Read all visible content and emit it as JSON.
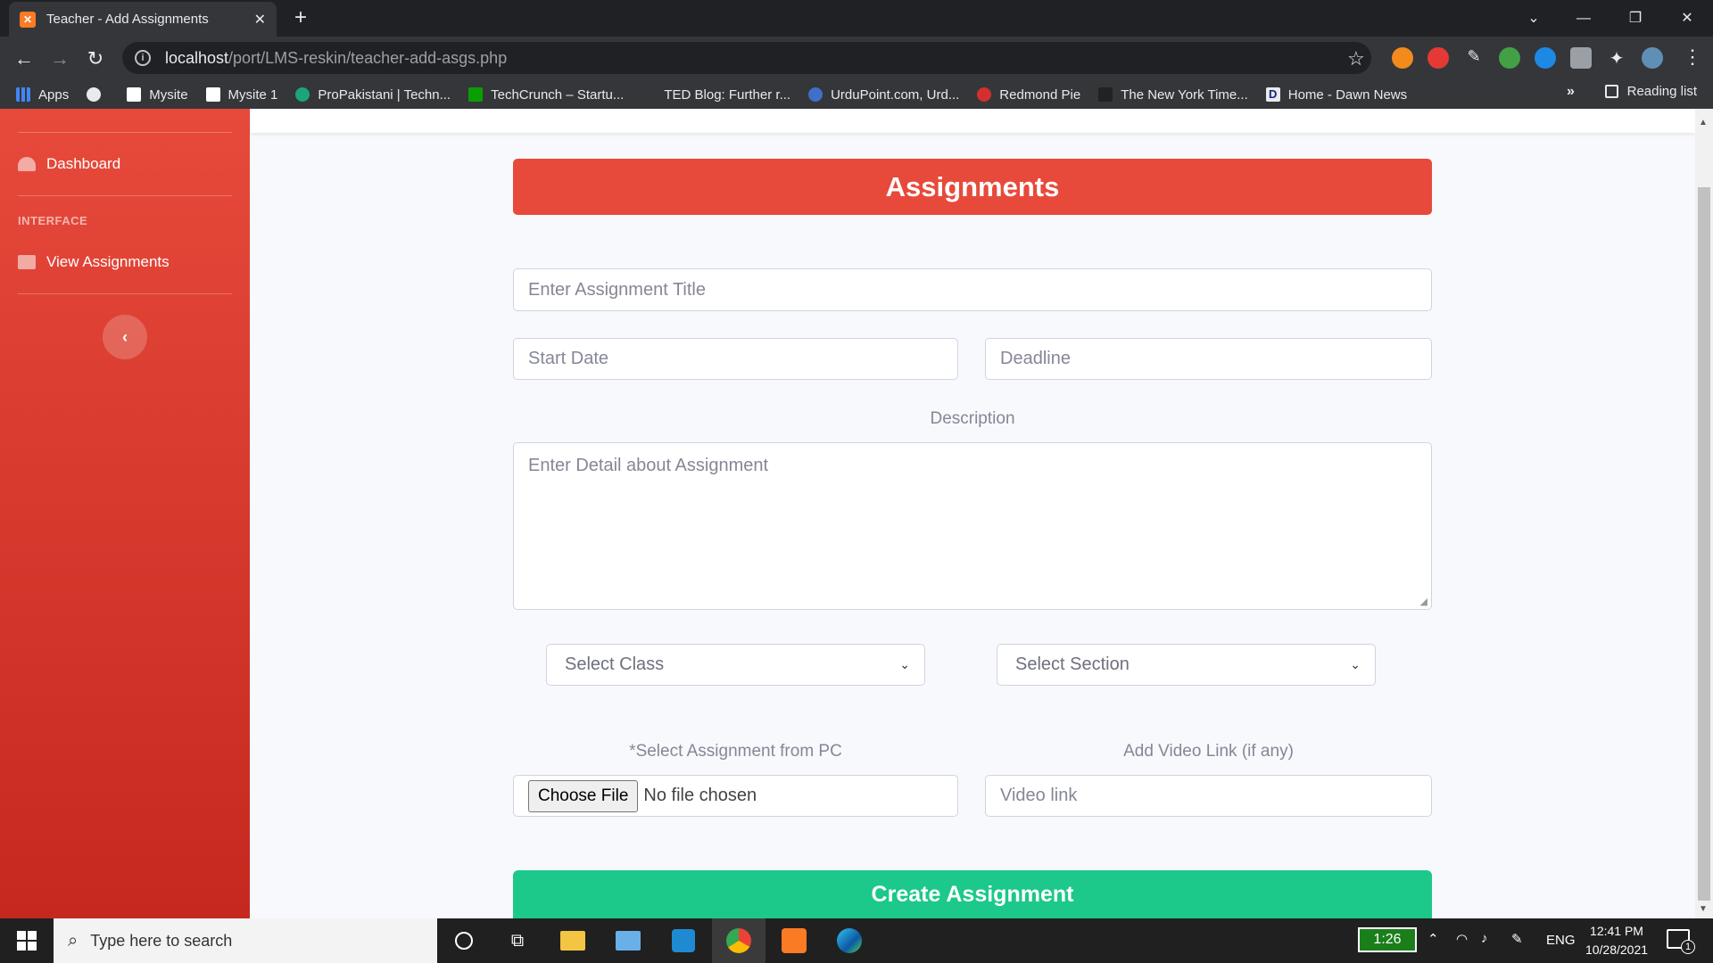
{
  "browser": {
    "tab_title": "Teacher - Add Assignments",
    "tab_favicon": "xampp-icon",
    "url_host": "localhost",
    "url_path": "/port/LMS-reskin/teacher-add-asgs.php",
    "bookmarks": [
      {
        "label": "Apps",
        "icon": "apps-grid-icon"
      },
      {
        "label": "",
        "icon": "globe-icon"
      },
      {
        "label": "Mysite",
        "icon": "wix-icon"
      },
      {
        "label": "Mysite 1",
        "icon": "wix-icon"
      },
      {
        "label": "ProPakistani | Techn...",
        "icon": "propakistani-icon"
      },
      {
        "label": "TechCrunch – Startu...",
        "icon": "techcrunch-icon"
      },
      {
        "label": "TED Blog: Further r...",
        "icon": "ted-icon"
      },
      {
        "label": "UrduPoint.com, Urd...",
        "icon": "urdupoint-icon"
      },
      {
        "label": "Redmond Pie",
        "icon": "redmondpie-icon"
      },
      {
        "label": "The New York Time...",
        "icon": "nyt-icon"
      },
      {
        "label": "Home - Dawn News",
        "icon": "dawn-icon"
      }
    ],
    "overflow": "»",
    "reading_list": "Reading list"
  },
  "sidebar": {
    "dashboard_label": "Dashboard",
    "section_heading": "INTERFACE",
    "view_assignments_label": "View Assignments",
    "toggle_symbol": "‹"
  },
  "form": {
    "header": "Assignments",
    "title_placeholder": "Enter Assignment Title",
    "start_date_placeholder": "Start Date",
    "deadline_placeholder": "Deadline",
    "description_label": "Description",
    "description_placeholder": "Enter Detail about Assignment",
    "class_select": "Select Class",
    "section_select": "Select Section",
    "file_label": "*Select Assignment from PC",
    "file_button": "Choose File",
    "file_status": "No file chosen",
    "video_label": "Add Video Link (if any)",
    "video_placeholder": "Video link",
    "submit": "Create Assignment"
  },
  "taskbar": {
    "search_placeholder": "Type here to search",
    "battery_time": "1:26",
    "language": "ENG",
    "time": "12:41 PM",
    "date": "10/28/2021",
    "notification_count": "1"
  },
  "colors": {
    "primary_red": "#e74a3b",
    "success_green": "#1cc88a"
  }
}
